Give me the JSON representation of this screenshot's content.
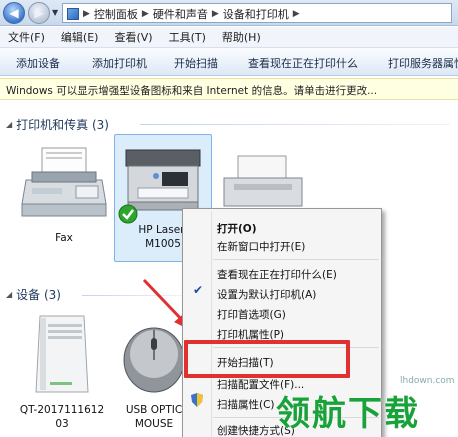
{
  "address": {
    "crumbs": [
      "控制面板",
      "硬件和声音",
      "设备和打印机"
    ]
  },
  "menubar": {
    "items": [
      "文件(F)",
      "编辑(E)",
      "查看(V)",
      "工具(T)",
      "帮助(H)"
    ]
  },
  "toolbar": {
    "items": [
      "添加设备",
      "添加打印机",
      "开始扫描",
      "查看现在正在打印什么",
      "打印服务器属性"
    ]
  },
  "infobar": {
    "text": "Windows 可以显示增强型设备图标和来自 Internet 的信息。请单击进行更改..."
  },
  "groups": {
    "printers": {
      "title": "打印机和传真 (3)"
    },
    "devices": {
      "title": "设备 (3)"
    }
  },
  "printers": [
    {
      "label": "Fax",
      "icon": "fax-icon"
    },
    {
      "label1": "HP LaserJ",
      "label2": "M1005",
      "icon": "multifunction-printer-icon",
      "default": true
    },
    {
      "icon": "printer-icon"
    }
  ],
  "devices": [
    {
      "label1": "QT-2017111612",
      "label2": "03",
      "icon": "computer-tower-icon"
    },
    {
      "label1": "USB OPTIC",
      "label2": "MOUSE",
      "icon": "mouse-icon"
    }
  ],
  "context_menu": {
    "open": "打开(O)",
    "open_new": "在新窗口中打开(E)",
    "see_printing": "查看现在正在打印什么(E)",
    "set_default": "设置为默认打印机(A)",
    "print_prefs": "打印首选项(G)",
    "printer_props": "打印机属性(P)",
    "start_scan": "开始扫描(T)",
    "scan_profiles": "扫描配置文件(F)...",
    "scan_props": "扫描属性(C)",
    "create_shortcut": "创建快捷方式(S)"
  },
  "watermark": {
    "url": "lhdown.com",
    "text": "领航下载"
  },
  "colors": {
    "highlight_box": "#e03131",
    "arrow": "#e03131",
    "watermark": "#1aa23a"
  }
}
